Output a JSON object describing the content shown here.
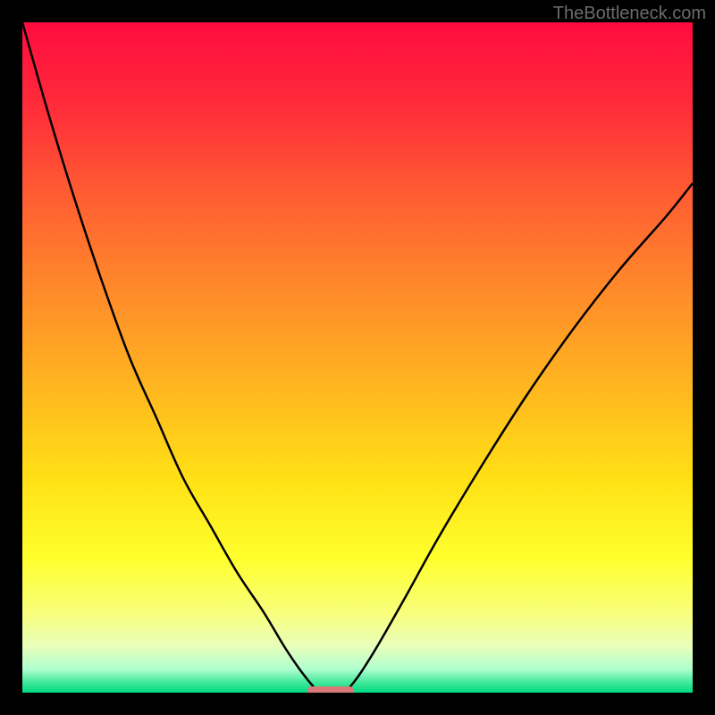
{
  "watermark": "TheBottleneck.com",
  "chart_data": {
    "type": "line",
    "title": "",
    "xlabel": "",
    "ylabel": "",
    "xlim": [
      0,
      100
    ],
    "ylim": [
      0,
      100
    ],
    "background_gradient": {
      "stops": [
        {
          "offset": 0.0,
          "color": "#ff0b3f"
        },
        {
          "offset": 0.12,
          "color": "#ff2a3a"
        },
        {
          "offset": 0.25,
          "color": "#ff5a33"
        },
        {
          "offset": 0.4,
          "color": "#ff8a2a"
        },
        {
          "offset": 0.55,
          "color": "#ffb81f"
        },
        {
          "offset": 0.68,
          "color": "#ffe015"
        },
        {
          "offset": 0.8,
          "color": "#ffff2d"
        },
        {
          "offset": 0.88,
          "color": "#f8ff7a"
        },
        {
          "offset": 0.93,
          "color": "#e8ffba"
        },
        {
          "offset": 0.965,
          "color": "#b0ffcf"
        },
        {
          "offset": 0.985,
          "color": "#40e89a"
        },
        {
          "offset": 1.0,
          "color": "#00d982"
        }
      ]
    },
    "series": [
      {
        "name": "curve-left",
        "x": [
          0,
          4,
          8,
          12,
          16,
          20,
          24,
          28,
          32,
          36,
          39,
          41,
          42.5,
          43.5,
          44
        ],
        "y": [
          100,
          86,
          73,
          61,
          50,
          41,
          32,
          25,
          18,
          12,
          7,
          4,
          2,
          0.8,
          0
        ]
      },
      {
        "name": "curve-right",
        "x": [
          48,
          49,
          50.5,
          53,
          57,
          62,
          68,
          75,
          82,
          89,
          96,
          100
        ],
        "y": [
          0,
          1,
          3,
          7,
          14,
          23,
          33,
          44,
          54,
          63,
          71,
          76
        ]
      }
    ],
    "marker": {
      "x_center": 46,
      "x_halfwidth": 3.5,
      "y": 0,
      "color": "#d87a7a"
    }
  }
}
